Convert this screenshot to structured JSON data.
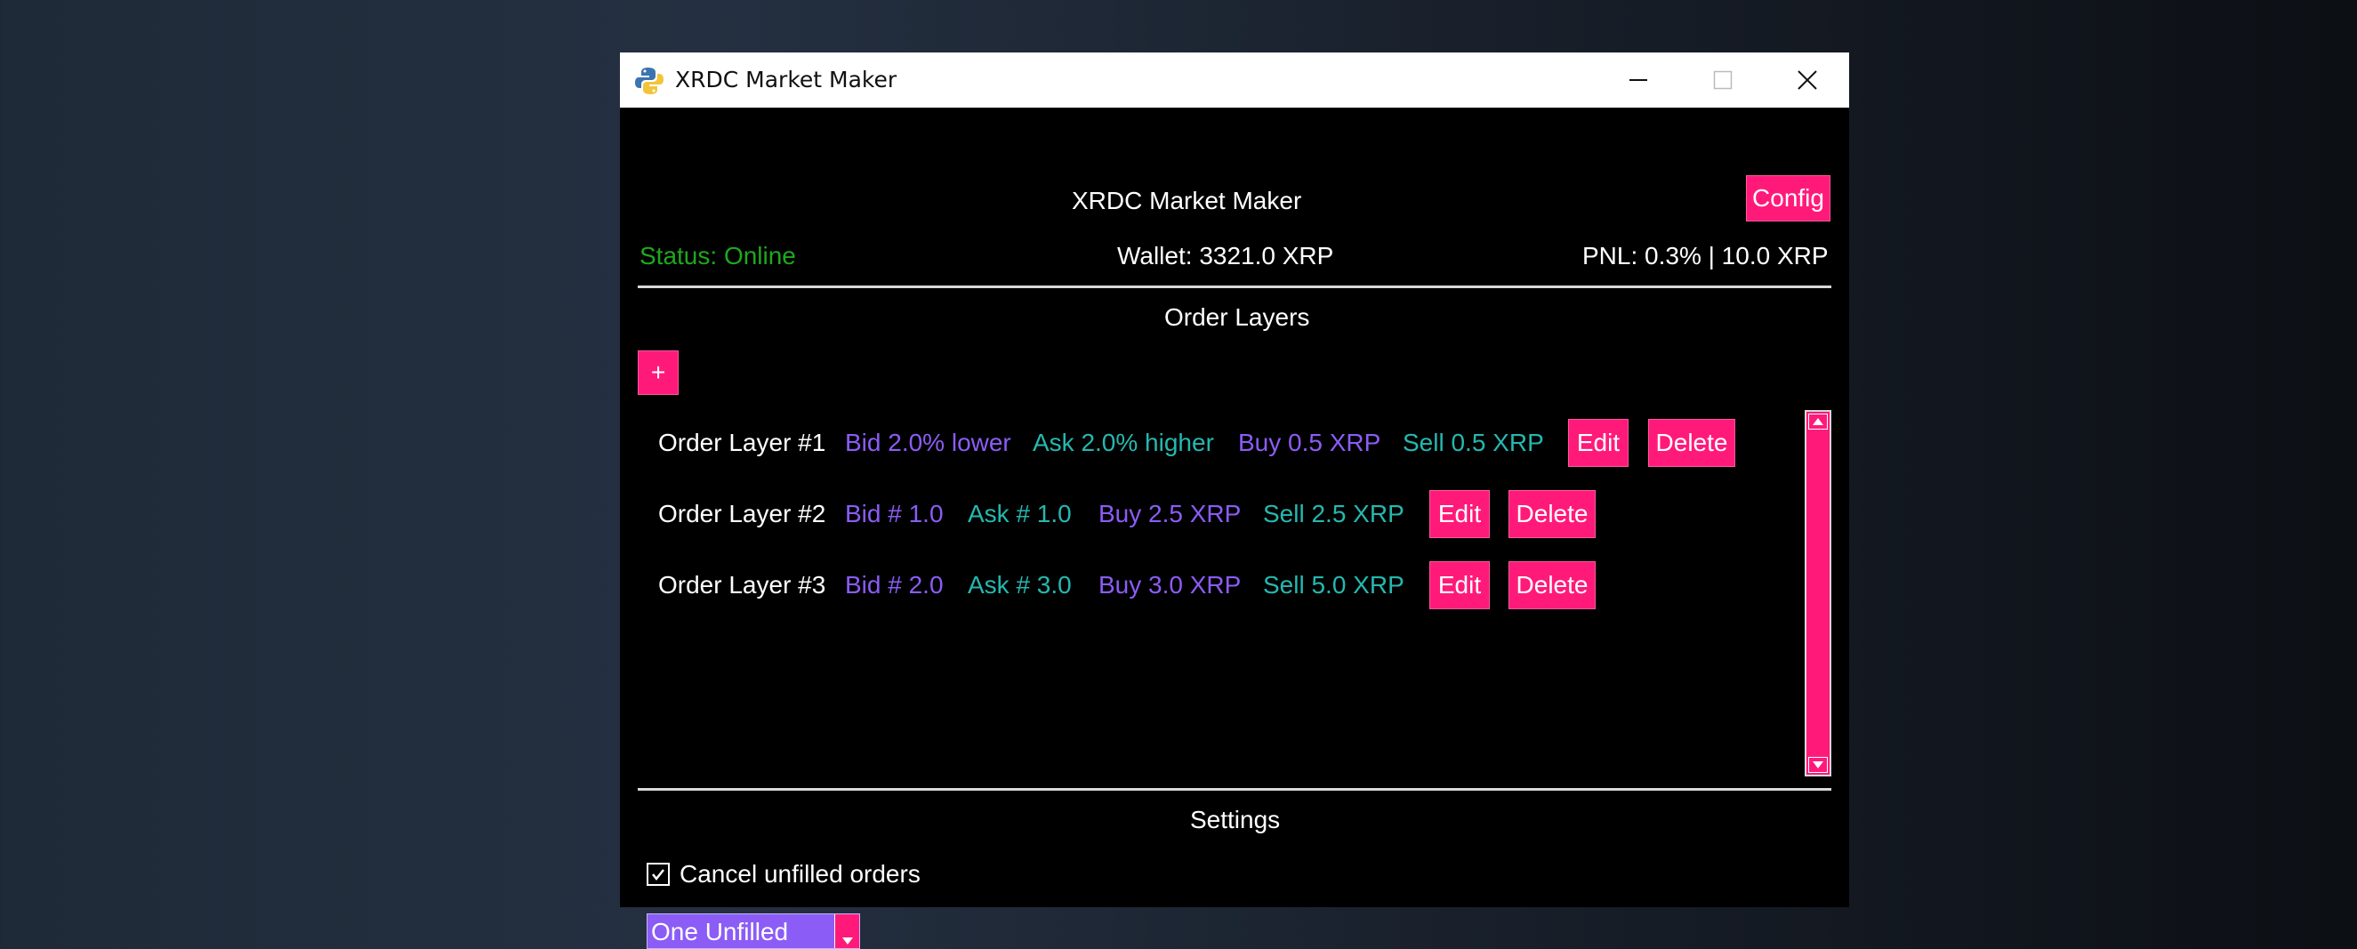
{
  "window": {
    "title": "XRDC Market Maker"
  },
  "header": {
    "title": "XRDC Market Maker",
    "config_label": "Config",
    "status": "Status: Online",
    "wallet": "Wallet: 3321.0 XRP",
    "pnl": "PNL: 0.3% | 10.0 XRP"
  },
  "order_layers": {
    "heading": "Order Layers",
    "add_label": "+",
    "rows": [
      {
        "name": "Order Layer #1",
        "bid": "Bid 2.0% lower",
        "ask": "Ask 2.0% higher",
        "buy": "Buy 0.5 XRP",
        "sell": "Sell 0.5 XRP",
        "edit": "Edit",
        "delete": "Delete"
      },
      {
        "name": "Order Layer #2",
        "bid": "Bid # 1.0",
        "ask": "Ask # 1.0",
        "buy": "Buy 2.5 XRP",
        "sell": "Sell 2.5 XRP",
        "edit": "Edit",
        "delete": "Delete"
      },
      {
        "name": "Order Layer #3",
        "bid": "Bid # 2.0",
        "ask": "Ask # 3.0",
        "buy": "Buy 3.0 XRP",
        "sell": "Sell 5.0 XRP",
        "edit": "Edit",
        "delete": "Delete"
      }
    ]
  },
  "settings": {
    "heading": "Settings",
    "cancel_unfilled_label": "Cancel unfilled orders",
    "cancel_unfilled_checked": true,
    "mode_selected": "One Unfilled"
  },
  "colors": {
    "accent": "#ff1a7a",
    "status_online": "#1ea81e",
    "purple_text": "#8b5cf6",
    "cyan_text": "#25b8b0"
  },
  "icons": {
    "app": "python-logo-icon",
    "minimize": "minimize-icon",
    "maximize": "maximize-icon",
    "close": "close-icon"
  }
}
